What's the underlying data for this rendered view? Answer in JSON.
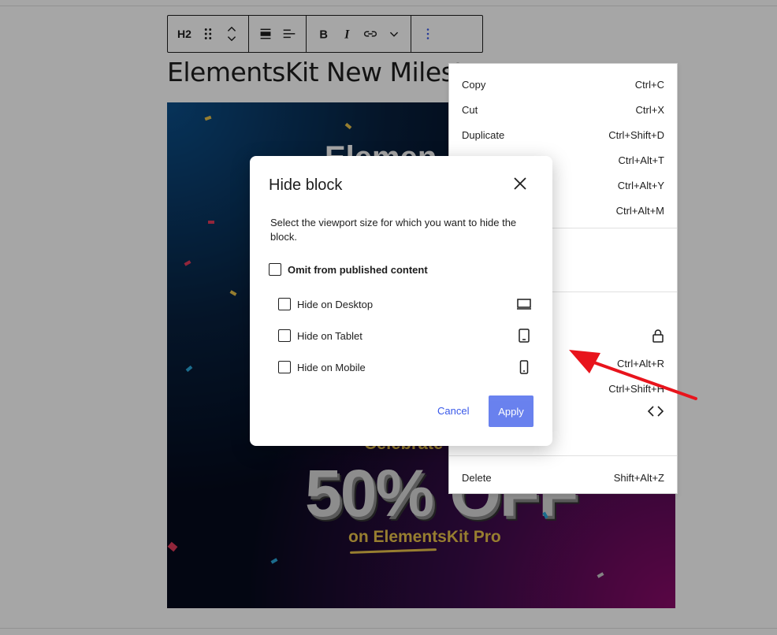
{
  "toolbar": {
    "heading_level": "H2"
  },
  "post": {
    "heading": "ElementsKit New Milesto"
  },
  "banner": {
    "logo_text": "Elemen",
    "celebrate_text": "Celebrate",
    "sale_text": "50% OFF",
    "subtitle": "on ElementsKit Pro"
  },
  "context_menu": {
    "items": [
      {
        "label": "Copy",
        "shortcut": "Ctrl+C"
      },
      {
        "label": "Cut",
        "shortcut": "Ctrl+X"
      },
      {
        "label": "Duplicate",
        "shortcut": "Ctrl+Shift+D"
      },
      {
        "label": "",
        "shortcut": "Ctrl+Alt+T"
      },
      {
        "label": "",
        "shortcut": "Ctrl+Alt+Y"
      },
      {
        "label": "",
        "shortcut": "Ctrl+Alt+M"
      },
      {
        "label": "",
        "shortcut": "Ctrl+Alt+R"
      },
      {
        "label": "",
        "shortcut": "Ctrl+Shift+H"
      },
      {
        "label": "Delete",
        "shortcut": "Shift+Alt+Z"
      }
    ]
  },
  "modal": {
    "title": "Hide block",
    "description": "Select the viewport size for which you want to hide the block.",
    "omit_label": "Omit from published content",
    "options": [
      {
        "label": "Hide on Desktop",
        "icon": "desktop-icon"
      },
      {
        "label": "Hide on Tablet",
        "icon": "tablet-icon"
      },
      {
        "label": "Hide on Mobile",
        "icon": "mobile-icon"
      }
    ],
    "cancel_label": "Cancel",
    "apply_label": "Apply"
  },
  "colors": {
    "accent": "#3858e9",
    "annotation_arrow": "#e8141c"
  }
}
